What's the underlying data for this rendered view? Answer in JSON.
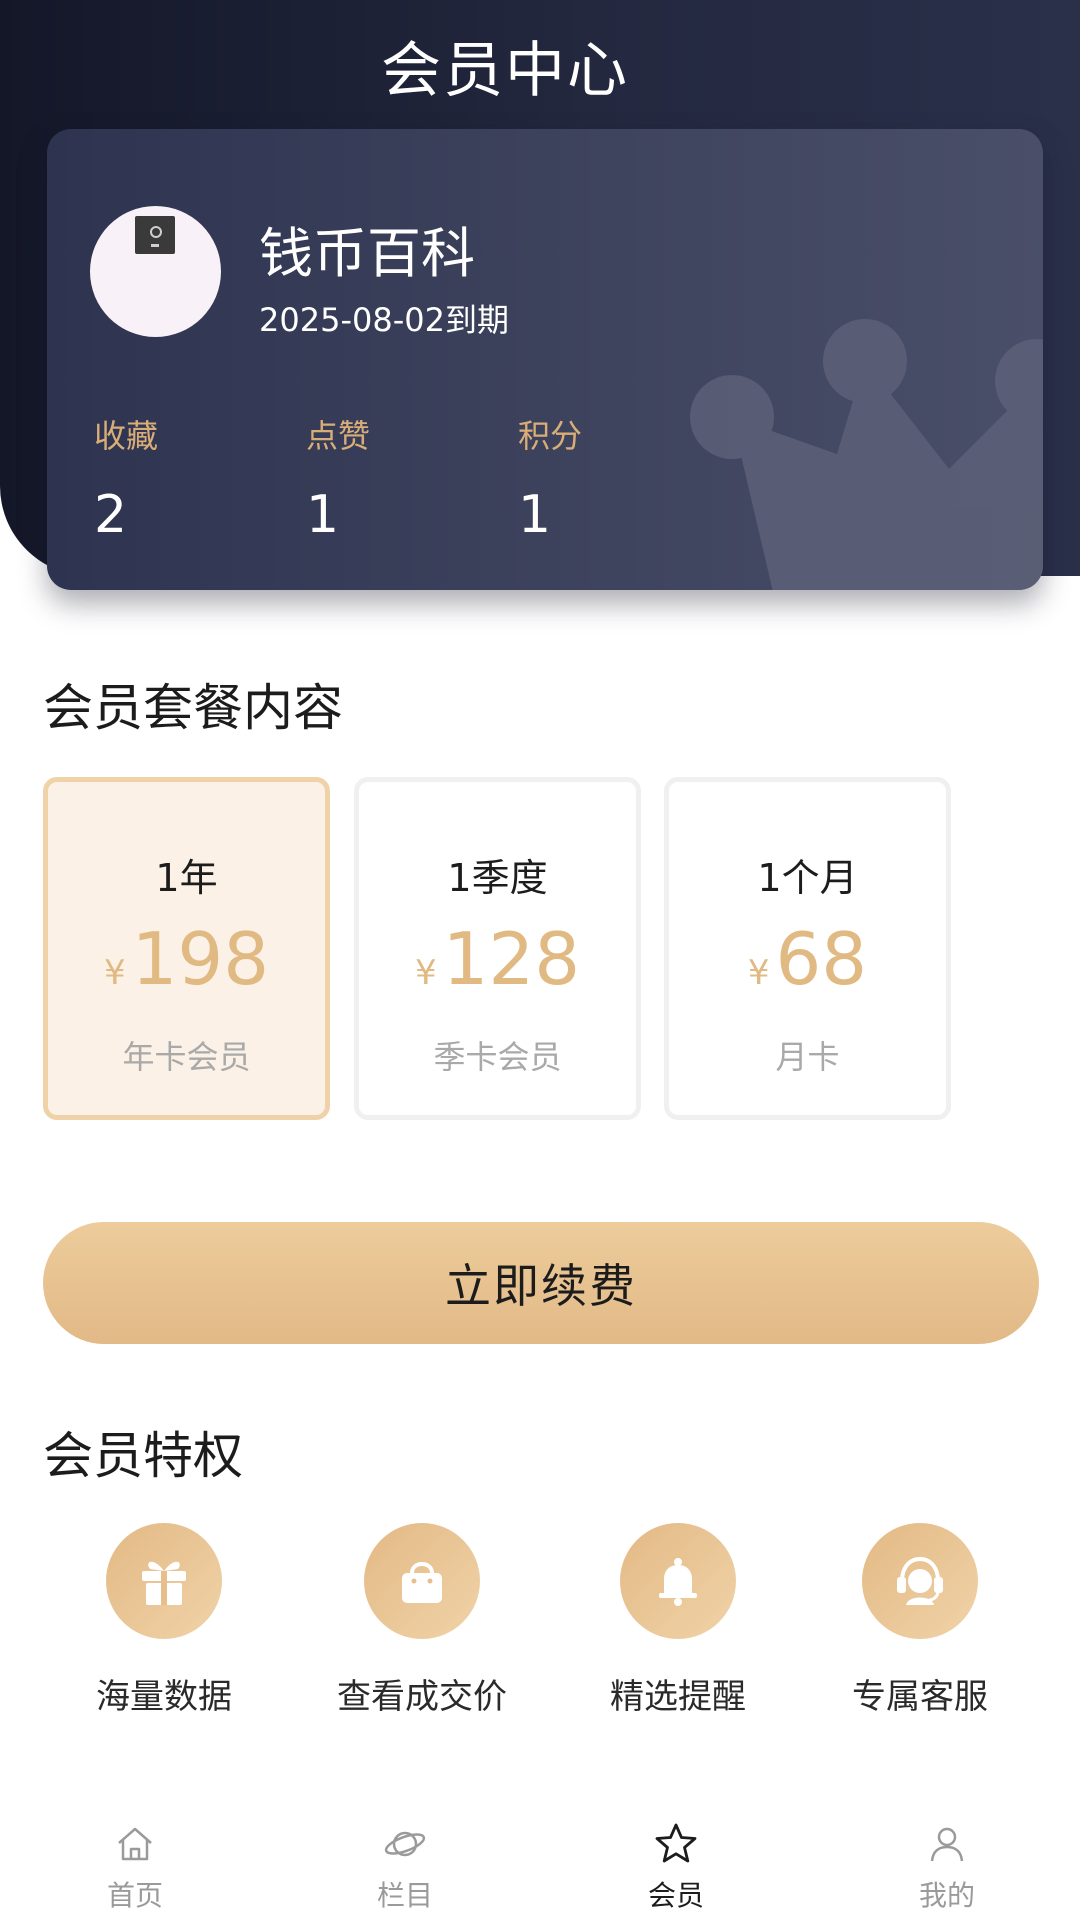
{
  "header": {
    "title": "会员中心"
  },
  "member": {
    "name": "钱币百科",
    "expiry": "2025-08-02到期",
    "stats": [
      {
        "label": "收藏",
        "value": "2"
      },
      {
        "label": "点赞",
        "value": "1"
      },
      {
        "label": "积分",
        "value": "1"
      }
    ]
  },
  "plans_section": {
    "title": "会员套餐内容",
    "selected_index": 0,
    "currency_symbol": "¥",
    "plans": [
      {
        "period": "1年",
        "price": "198",
        "desc": "年卡会员"
      },
      {
        "period": "1季度",
        "price": "128",
        "desc": "季卡会员"
      },
      {
        "period": "1个月",
        "price": "68",
        "desc": "月卡"
      }
    ]
  },
  "renew_button": {
    "label": "立即续费"
  },
  "perks_section": {
    "title": "会员特权",
    "items": [
      {
        "label": "海量数据",
        "icon": "gift-icon"
      },
      {
        "label": "查看成交价",
        "icon": "shopping-bag-icon"
      },
      {
        "label": "精选提醒",
        "icon": "bell-icon"
      },
      {
        "label": "专属客服",
        "icon": "headset-icon"
      }
    ]
  },
  "tabbar": {
    "active_index": 2,
    "items": [
      {
        "label": "首页",
        "icon": "home-icon"
      },
      {
        "label": "栏目",
        "icon": "planet-icon"
      },
      {
        "label": "会员",
        "icon": "star-icon"
      },
      {
        "label": "我的",
        "icon": "user-icon"
      }
    ]
  },
  "colors": {
    "header_dark": "#1a1e33",
    "gold": "#e0ba82",
    "gold_light": "#efd2a8",
    "selected_plan_bg": "#fbf1e6"
  }
}
